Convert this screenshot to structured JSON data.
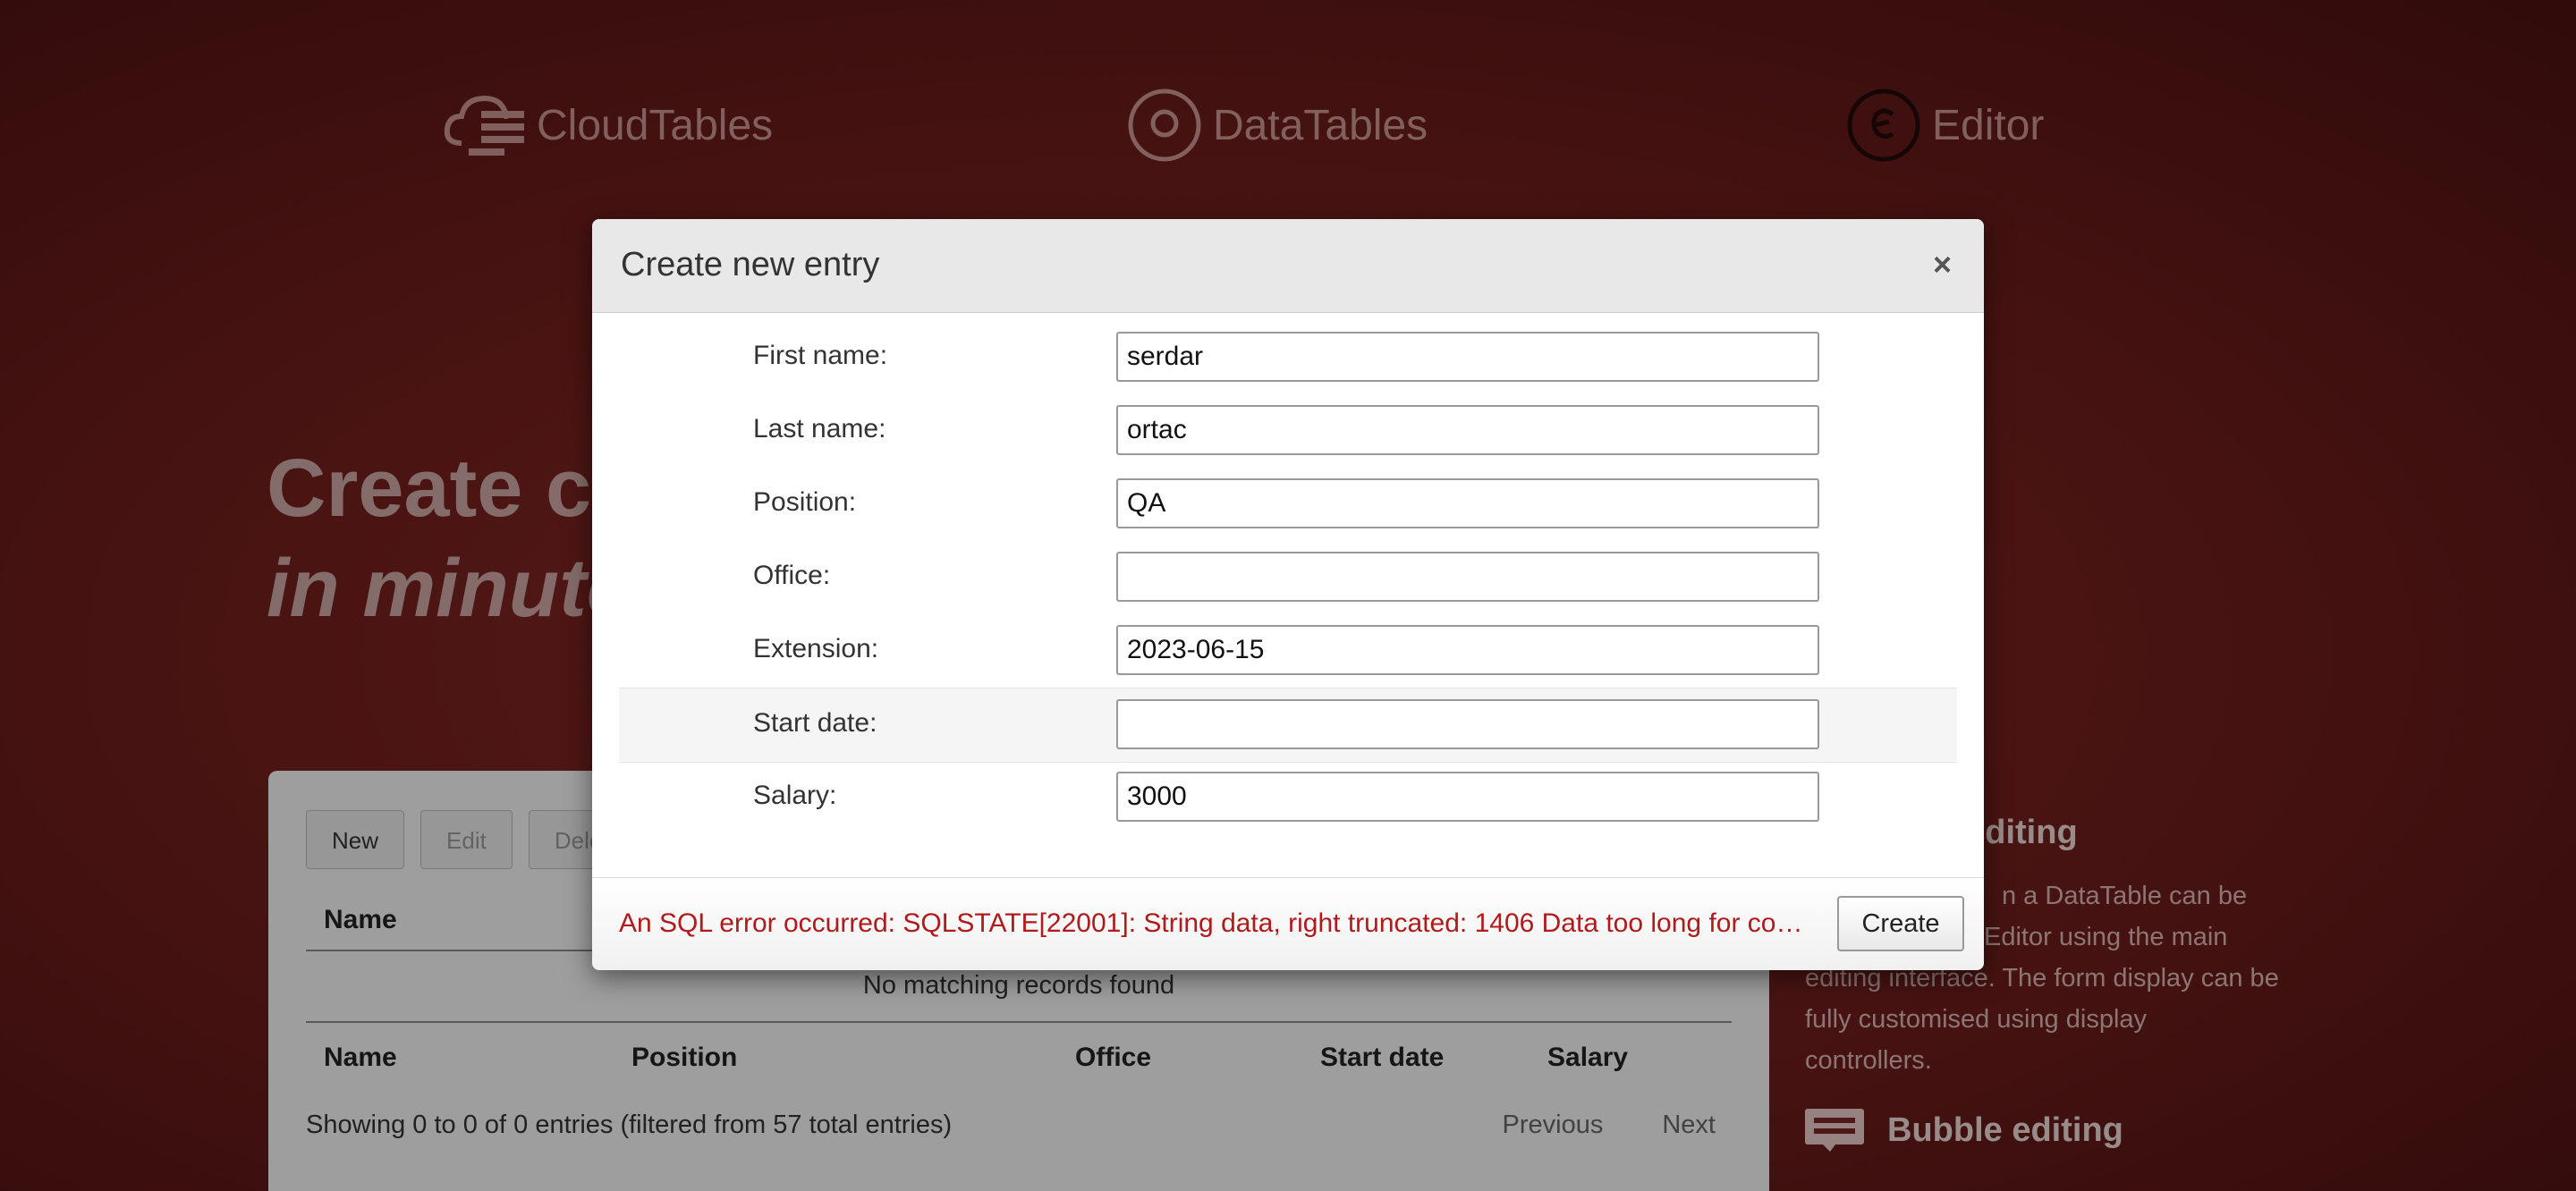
{
  "header_logos": {
    "cloudtables": "CloudTables",
    "datatables": "DataTables",
    "editor": "Editor"
  },
  "hero": {
    "line1": "Create cu",
    "line2": "in minute"
  },
  "table_panel": {
    "buttons": {
      "new": "New",
      "edit": "Edit",
      "delete": "Dele"
    },
    "columns": [
      "Name",
      "Position",
      "Office",
      "Start date",
      "Salary"
    ],
    "empty_message": "No matching records found",
    "info": "Showing 0 to 0 of 0 entries (filtered from 57 total entries)",
    "pager": {
      "previous": "Previous",
      "next": "Next"
    }
  },
  "side": {
    "row_editing_title": "w editing",
    "row_editing_text_1": "n a DataTable can be",
    "row_editing_text_2": "Editor using the main",
    "row_editing_text_3": "editing interface. The form display can be",
    "row_editing_text_4": "fully customised using display",
    "row_editing_text_5": "controllers.",
    "bubble_title": "Bubble editing"
  },
  "modal": {
    "title": "Create new entry",
    "close_label": "×",
    "fields": [
      {
        "label": "First name:",
        "value": "serdar"
      },
      {
        "label": "Last name:",
        "value": "ortac"
      },
      {
        "label": "Position:",
        "value": "QA"
      },
      {
        "label": "Office:",
        "value": ""
      },
      {
        "label": "Extension:",
        "value": "2023-06-15"
      },
      {
        "label": "Start date:",
        "value": ""
      },
      {
        "label": "Salary:",
        "value": "3000"
      }
    ],
    "error": "An SQL error occurred: SQLSTATE[22001]: String data, right truncated: 1406 Data too long for colum…",
    "create_label": "Create"
  }
}
